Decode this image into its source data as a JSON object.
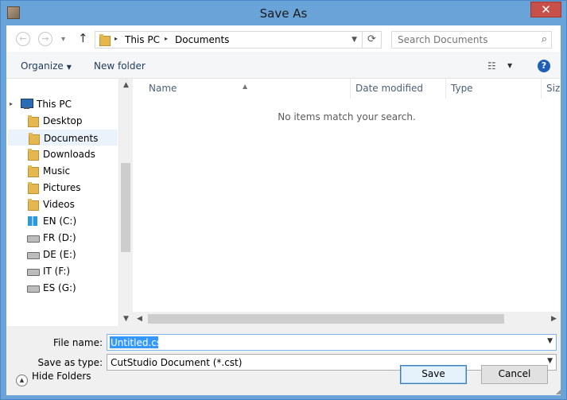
{
  "window": {
    "title": "Save As",
    "close_glyph": "✕"
  },
  "nav": {
    "back_glyph": "←",
    "forward_glyph": "→",
    "recent_glyph": "▾",
    "up_glyph": "↑",
    "breadcrumbs": [
      "This PC",
      "Documents"
    ],
    "crumb_sep": "▸",
    "refresh_glyph": "⟳"
  },
  "search": {
    "placeholder": "Search Documents",
    "glyph": "⌕"
  },
  "toolbar": {
    "organize_label": "Organize",
    "new_folder_label": "New folder",
    "view_glyph": "☷",
    "help_glyph": "?"
  },
  "tree": {
    "items": [
      {
        "label": "This PC",
        "icon": "pc-icon"
      },
      {
        "label": "Desktop",
        "icon": "folder-icon"
      },
      {
        "label": "Documents",
        "icon": "folder-icon",
        "selected": true
      },
      {
        "label": "Downloads",
        "icon": "folder-icon"
      },
      {
        "label": "Music",
        "icon": "folder-icon"
      },
      {
        "label": "Pictures",
        "icon": "folder-icon"
      },
      {
        "label": "Videos",
        "icon": "folder-icon"
      },
      {
        "label": "EN (C:)",
        "icon": "windows-drive-icon"
      },
      {
        "label": "FR (D:)",
        "icon": "drive-icon"
      },
      {
        "label": "DE (E:)",
        "icon": "drive-icon"
      },
      {
        "label": "IT (F:)",
        "icon": "drive-icon"
      },
      {
        "label": "ES (G:)",
        "icon": "drive-icon"
      }
    ]
  },
  "file_list": {
    "columns": [
      "Name",
      "Date modified",
      "Type",
      "Size"
    ],
    "empty_message": "No items match your search."
  },
  "form": {
    "file_name_label": "File name:",
    "file_name_value": "Untitled.cst",
    "save_type_label": "Save as type:",
    "save_type_value": "CutStudio Document (*.cst)"
  },
  "footer": {
    "hide_folders_label": "Hide Folders",
    "save_label": "Save",
    "cancel_label": "Cancel"
  },
  "colors": {
    "frame": "#6aa3d8",
    "close": "#c7504a",
    "selection": "#3399ff",
    "tree_selected": "#eaf3fc"
  }
}
